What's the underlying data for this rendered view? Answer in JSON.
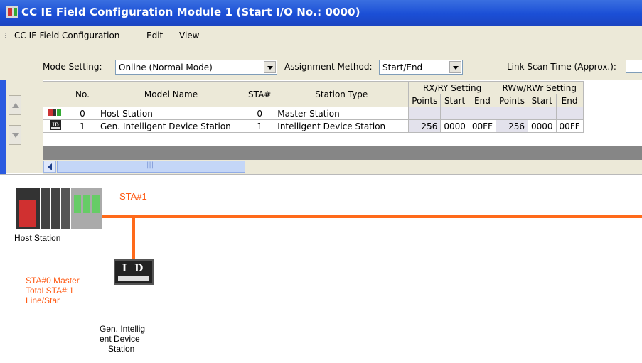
{
  "window": {
    "title": "CC IE Field Configuration Module 1 (Start I/O No.: 0000)"
  },
  "menubar": {
    "items": [
      {
        "label": "CC IE Field Configuration"
      },
      {
        "label": "Edit"
      },
      {
        "label": "View"
      }
    ]
  },
  "toolbar": {
    "mode_label": "Mode Setting:",
    "mode_value": "Online (Normal Mode)",
    "assign_label": "Assignment Method:",
    "assign_value": "Start/End",
    "scan_label": "Link Scan Time (Approx.):"
  },
  "table": {
    "headers": {
      "no": "No.",
      "model": "Model Name",
      "sta": "STA#",
      "type": "Station Type",
      "rx_group": "RX/RY Setting",
      "rw_group": "RWw/RWr Setting",
      "points": "Points",
      "start": "Start",
      "end": "End"
    },
    "rows": [
      {
        "no": "0",
        "model": "Host Station",
        "sta": "0",
        "type": "Master Station",
        "rx_points": "",
        "rx_start": "",
        "rx_end": "",
        "rw_points": "",
        "rw_start": "",
        "rw_end": ""
      },
      {
        "no": "1",
        "model": "Gen. Intelligent Device Station",
        "sta": "1",
        "type": "Intelligent Device Station",
        "rx_points": "256",
        "rx_start": "0000",
        "rx_end": "00FF",
        "rw_points": "256",
        "rw_start": "0000",
        "rw_end": "00FF"
      }
    ]
  },
  "diagram": {
    "sta_label": "STA#1",
    "host_label": "Host Station",
    "info_line1": "STA#0  Master",
    "info_line2": "Total STA#:1",
    "info_line3": "Line/Star",
    "device_icon_text": "I D",
    "device_label_line1": "Gen. Intellig",
    "device_label_line2": "ent Device",
    "device_label_line3": "Station"
  },
  "colors": {
    "title_blue": "#1b4fd6",
    "network_orange": "#ff6a1a",
    "panel": "#ece9d8"
  }
}
